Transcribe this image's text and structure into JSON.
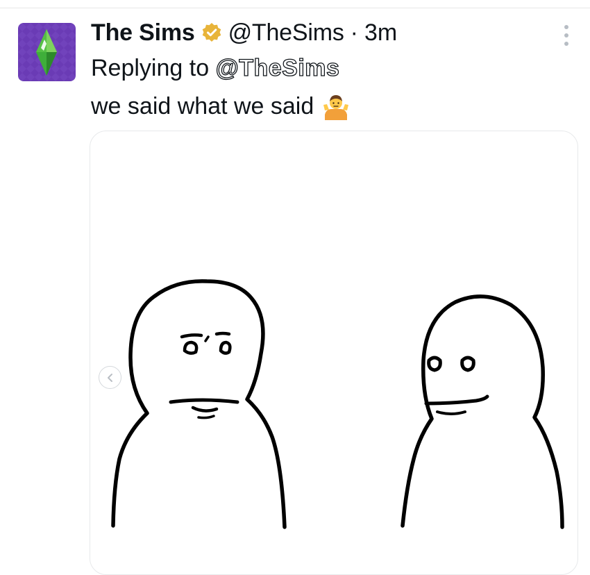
{
  "tweet": {
    "display_name": "The Sims",
    "handle": "@TheSims",
    "separator": "·",
    "time": "3m",
    "replying_to_prefix": "Replying to",
    "replying_to_handle": "@TheSims",
    "text": "we said what we said",
    "emoji": "person-shrugging-emoji"
  },
  "icons": {
    "avatar": "plumbob-logo",
    "verified": "gold-verified-badge-icon",
    "more": "more-vertical-icon",
    "carousel_prev": "chevron-left-icon"
  },
  "colors": {
    "avatar_bg": "#6a3bb5",
    "plumbob": "#3fae3a",
    "verified_gold": "#e8b43a",
    "text": "#0f1419",
    "border": "#e7e9eb"
  }
}
